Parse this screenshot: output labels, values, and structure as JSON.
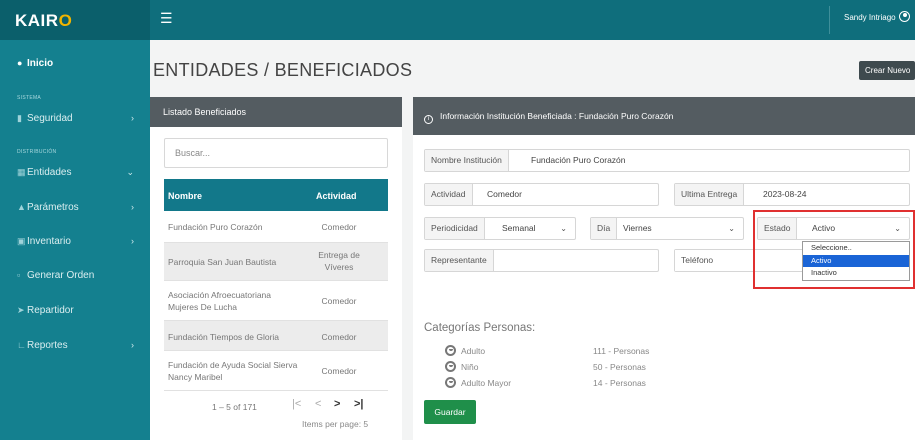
{
  "header": {
    "brand_main": "KAIR",
    "brand_accent": "O",
    "menu_icon": "hamburger-icon",
    "user_name": "Sandy Intriago",
    "user_icon": "user-circle-icon"
  },
  "sidebar": {
    "inicio": "Inicio",
    "section_sistema": "SISTEMA",
    "seguridad": "Seguridad",
    "section_distribucion": "DISTRIBUCIÓN",
    "entidades": "Entidades",
    "parametros": "Parámetros",
    "inventario": "Inventario",
    "generar_orden": "Generar Orden",
    "repartidor": "Repartidor",
    "reportes": "Reportes"
  },
  "main": {
    "title": "ENTIDADES / BENEFICIADOS",
    "new_button": "Crear Nuevo"
  },
  "list": {
    "title": "Listado Beneficiados",
    "search_placeholder": "Buscar...",
    "columns": {
      "name": "Nombre",
      "activity": "Actividad"
    },
    "rows": [
      {
        "name": "Fundación Puro Corazón",
        "activity": "Comedor"
      },
      {
        "name": "Parroquia San Juan Bautista",
        "activity": "Entrega de Víveres"
      },
      {
        "name": "Asociación Afroecuatoriana Mujeres De Lucha",
        "activity": "Comedor"
      },
      {
        "name": "Fundación Tiempos de Gloria",
        "activity": "Comedor"
      },
      {
        "name": "Fundación de Ayuda Social Sierva Nancy Maribel",
        "activity": "Comedor"
      }
    ],
    "pager": {
      "range": "1 – 5 of 171",
      "first": "|<",
      "prev": "<",
      "next": ">",
      "last": ">|",
      "items_per_page": "Items per page: 5"
    }
  },
  "detail": {
    "header": "Información Institución Beneficiada : Fundación Puro Corazón",
    "nombre_label": "Nombre Institución",
    "nombre_value": "Fundación Puro Corazón",
    "actividad_label": "Actividad",
    "actividad_value": "Comedor",
    "ultima_label": "Ultima Entrega",
    "ultima_value": "2023-08-24",
    "periodicidad_label": "Periodicidad",
    "periodicidad_value": "Semanal",
    "dia_label": "Día",
    "dia_value": "Viernes",
    "estado_label": "Estado",
    "estado_value": "Activo",
    "estado_options": [
      "Seleccione..",
      "Activo",
      "Inactivo"
    ],
    "representante_label": "Representante",
    "representante_value": "",
    "telefono_label": "Teléfono",
    "telefono_value": "",
    "categories_title": "Categorías Personas:",
    "categories": [
      {
        "name": "Adulto",
        "count": "111 - Personas"
      },
      {
        "name": "Niño",
        "count": "50 - Personas"
      },
      {
        "name": "Adulto Mayor",
        "count": "14 - Personas"
      }
    ],
    "save_button": "Guardar"
  },
  "colors": {
    "topbar": "#0f6e7c",
    "sidebar": "#14808f",
    "table_header": "#12788a",
    "panel_header": "#545c61",
    "save": "#1f8f4a",
    "highlight": "#e03030",
    "selected_option": "#1a64d6"
  }
}
